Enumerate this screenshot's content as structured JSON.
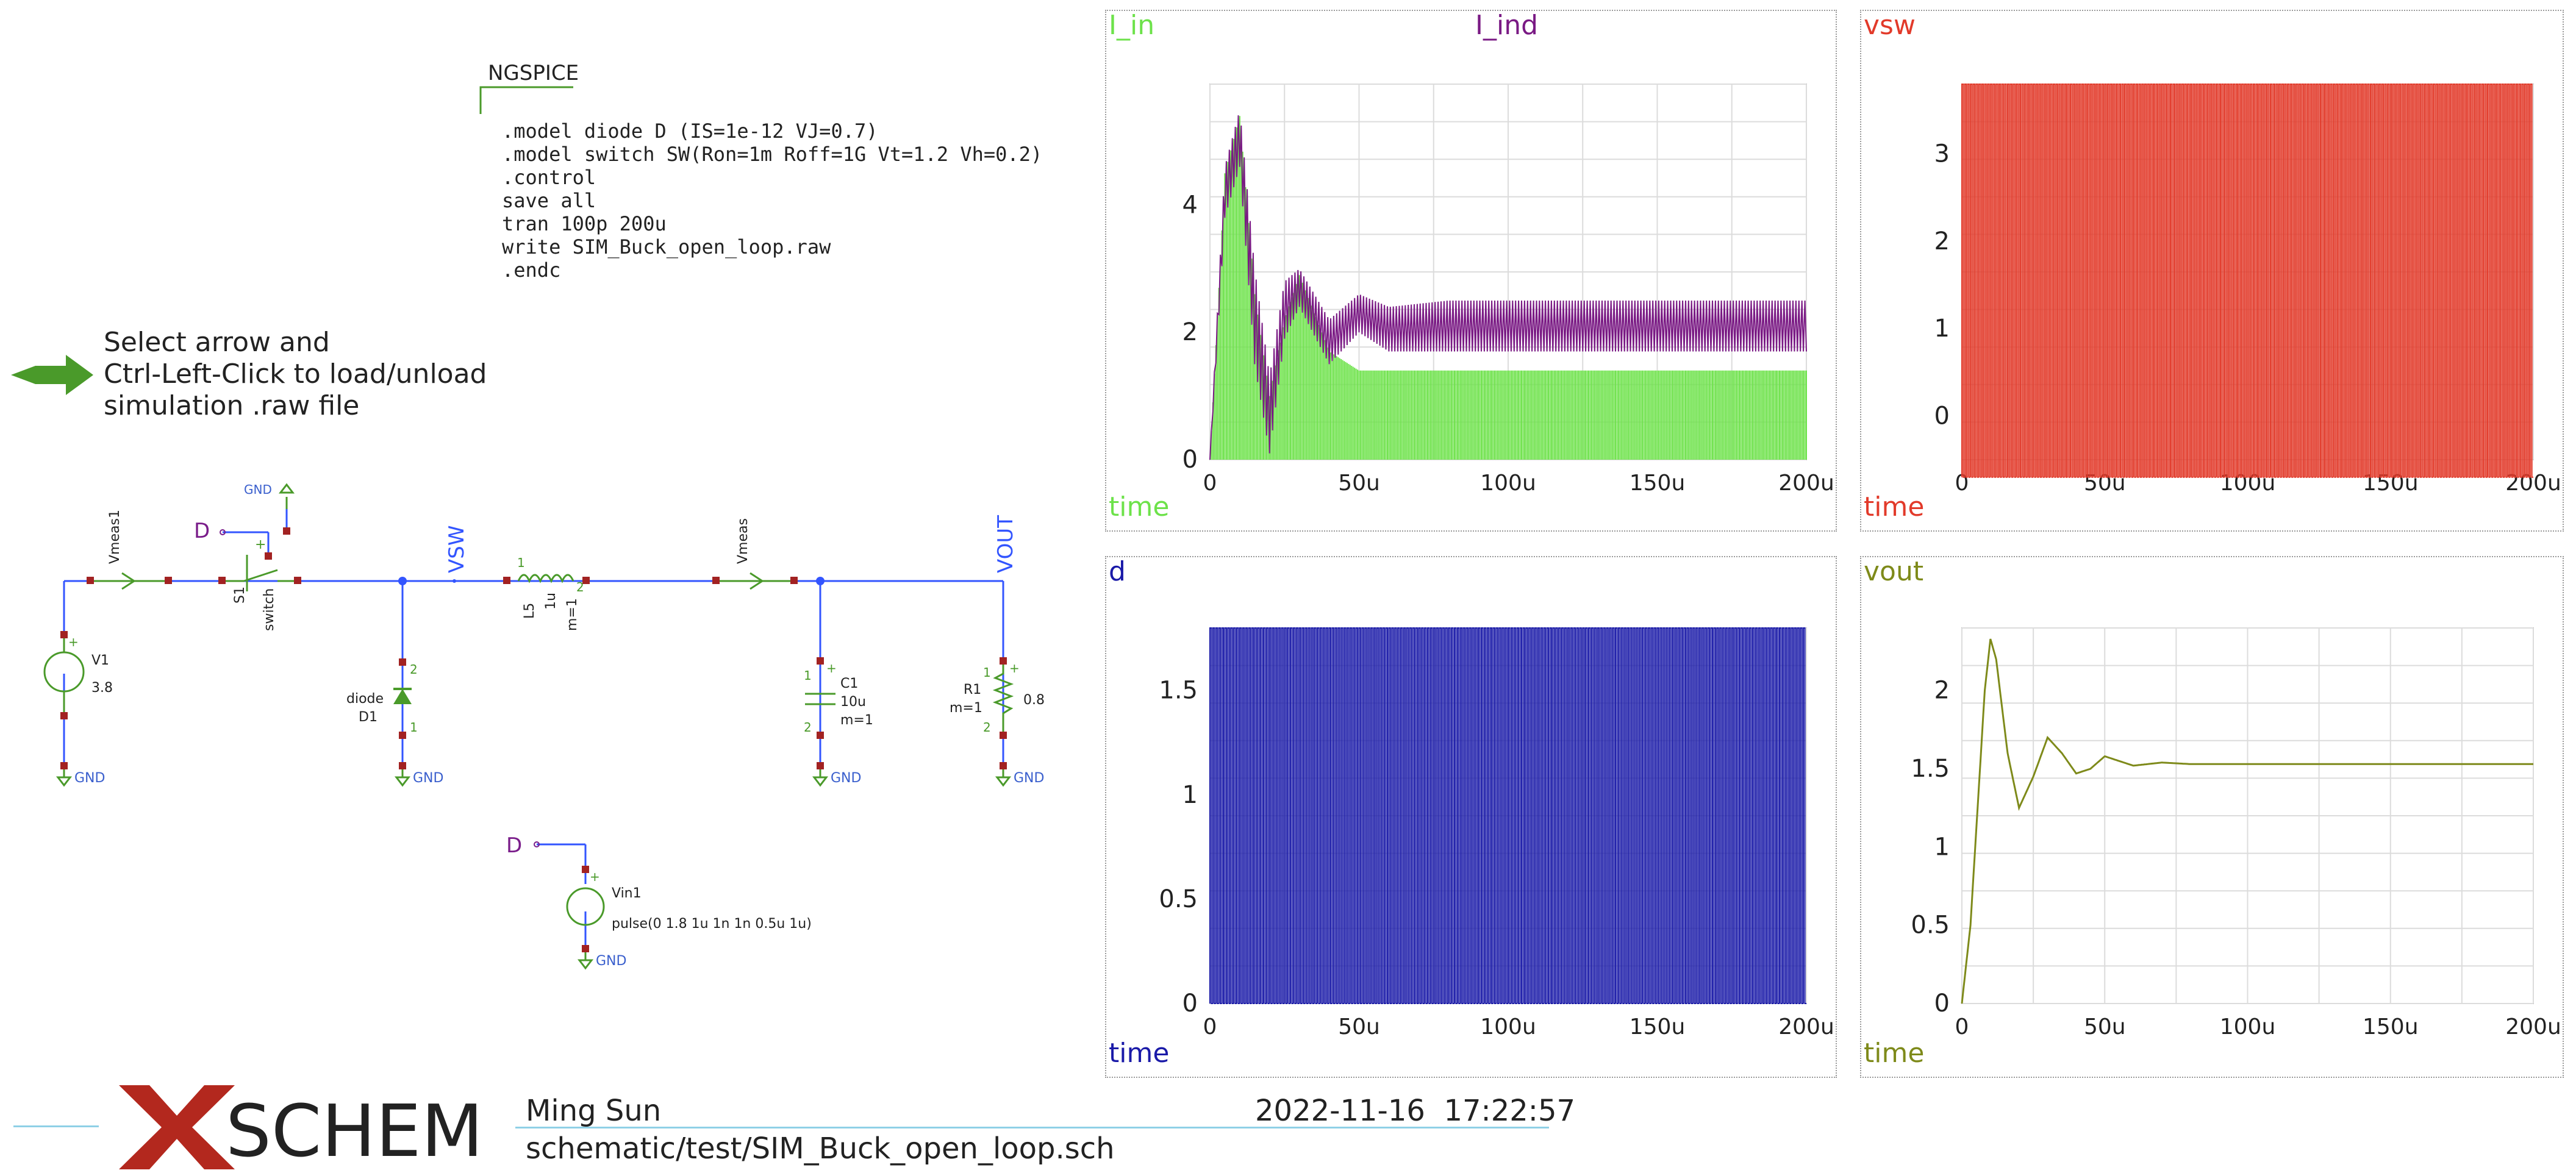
{
  "colors": {
    "wire": "#3355ff",
    "component": "#4a9a2a",
    "pin": "#a22222",
    "gnd_label": "#3a5fcd",
    "net_d": "#7a1d8a",
    "i_in": "#6de24a",
    "i_ind": "#7a1a84",
    "vsw": "#e23a2a",
    "d": "#1a1aa8",
    "vout": "#7e8a1a",
    "xschem_x": "#b3281e"
  },
  "ngspice": {
    "title": "NGSPICE",
    "lines": [
      ".model diode D (IS=1e-12 VJ=0.7)",
      ".model switch SW(Ron=1m Roff=1G Vt=1.2 Vh=0.2)",
      ".control",
      "save all",
      "tran 100p 200u",
      "write SIM_Buck_open_loop.raw",
      ".endc"
    ]
  },
  "load_hint": {
    "icon": "green-arrow-icon",
    "lines": [
      "Select arrow and",
      "Ctrl-Left-Click to load/unload",
      "simulation .raw file"
    ]
  },
  "schematic": {
    "vmeas1": "Vmeas1",
    "s1_name": "S1",
    "s1_model": "switch",
    "d_net": "D",
    "gnd": "GND",
    "vsw": "VSW",
    "l5_name": "L5",
    "l5_val": "1u",
    "l5_m": "m=1",
    "pin1": "1",
    "pin2": "2",
    "vmeas": "Vmeas",
    "vout": "VOUT",
    "v1_name": "V1",
    "v1_val": "3.8",
    "diode_model": "diode",
    "diode_name": "D1",
    "c1_name": "C1",
    "c1_val": "10u",
    "c1_m": "m=1",
    "r1_name": "R1",
    "r1_m": "m=1",
    "r1_val": "0.8",
    "vin1_name": "Vin1",
    "vin1_val": "pulse(0 1.8 1u 1n 1n 0.5u 1u)"
  },
  "graphs": [
    {
      "id": "graph-current",
      "titles": [
        {
          "text": "I_in",
          "color": "#6de24a"
        },
        {
          "text": "I_ind",
          "color": "#7a1a84"
        }
      ],
      "xlabel": "time",
      "xlabel_color": "#6de24a",
      "x_ticks": [
        "0",
        "50u",
        "100u",
        "150u",
        "200u"
      ],
      "y_ticks": [
        "0",
        "2",
        "4"
      ],
      "y_tick_values": [
        0,
        2,
        4
      ],
      "ylim": [
        0,
        5.9
      ],
      "xlim": [
        0,
        200
      ]
    },
    {
      "id": "graph-vsw",
      "titles": [
        {
          "text": "vsw",
          "color": "#e23a2a"
        }
      ],
      "xlabel": "time",
      "xlabel_color": "#e23a2a",
      "x_ticks": [
        "0",
        "50u",
        "100u",
        "150u",
        "200u"
      ],
      "y_ticks": [
        "0",
        "1",
        "2",
        "3"
      ],
      "y_tick_values": [
        0,
        1,
        2,
        3
      ],
      "ylim": [
        -0.5,
        3.8
      ],
      "xlim": [
        0,
        200
      ]
    },
    {
      "id": "graph-d",
      "titles": [
        {
          "text": "d",
          "color": "#1a1aa8"
        }
      ],
      "xlabel": "time",
      "xlabel_color": "#1a1aa8",
      "x_ticks": [
        "0",
        "50u",
        "100u",
        "150u",
        "200u"
      ],
      "y_ticks": [
        "0",
        "0.5",
        "1",
        "1.5"
      ],
      "y_tick_values": [
        0,
        0.5,
        1,
        1.5
      ],
      "ylim": [
        0,
        1.8
      ],
      "xlim": [
        0,
        200
      ]
    },
    {
      "id": "graph-vout",
      "titles": [
        {
          "text": "vout",
          "color": "#7e8a1a"
        }
      ],
      "xlabel": "time",
      "xlabel_color": "#7e8a1a",
      "x_ticks": [
        "0",
        "50u",
        "100u",
        "150u",
        "200u"
      ],
      "y_ticks": [
        "0",
        "0.5",
        "1",
        "1.5",
        "2"
      ],
      "y_tick_values": [
        0,
        0.5,
        1,
        1.5,
        2
      ],
      "ylim": [
        0,
        2.4
      ],
      "xlim": [
        0,
        200
      ]
    }
  ],
  "chart_data": [
    {
      "type": "line",
      "xlabel": "time",
      "ylabel": "",
      "xlim": [
        0,
        200
      ],
      "ylim": [
        0,
        5.9
      ],
      "series": [
        {
          "name": "I_in",
          "note": "switched waveform, envelope shown",
          "x": [
            0,
            5,
            10,
            15,
            20,
            25,
            30,
            40,
            50,
            60,
            80,
            100,
            150,
            200
          ],
          "y_max": [
            0,
            4.5,
            5.4,
            2.6,
            1.0,
            2.2,
            2.9,
            1.7,
            1.4,
            1.4,
            1.4,
            1.4,
            1.4,
            1.4
          ]
        },
        {
          "name": "I_ind",
          "x": [
            0,
            5,
            10,
            15,
            20,
            25,
            30,
            40,
            50,
            60,
            80,
            100,
            150,
            200
          ],
          "y_max": [
            0,
            4.6,
            5.5,
            3.0,
            1.3,
            2.8,
            3.0,
            2.2,
            2.6,
            2.4,
            2.5,
            2.5,
            2.5,
            2.5
          ],
          "y_min": [
            0,
            3.8,
            4.6,
            1.5,
            0.1,
            1.9,
            2.4,
            1.5,
            2.0,
            1.7,
            1.7,
            1.7,
            1.7,
            1.7
          ]
        }
      ]
    },
    {
      "type": "line",
      "xlabel": "time",
      "ylabel": "",
      "xlim": [
        0,
        200
      ],
      "ylim": [
        -0.5,
        3.8
      ],
      "series": [
        {
          "name": "vsw",
          "note": "square wave between approx -0.7 and 3.8",
          "x": [
            0,
            200
          ],
          "y_max": [
            3.8,
            3.8
          ],
          "y_min": [
            -0.7,
            -0.7
          ]
        }
      ]
    },
    {
      "type": "line",
      "xlabel": "time",
      "ylabel": "",
      "xlim": [
        0,
        200
      ],
      "ylim": [
        0,
        1.8
      ],
      "series": [
        {
          "name": "d",
          "note": "pulse between 0 and 1.8, period 1u",
          "x": [
            0,
            200
          ],
          "y_max": [
            1.8,
            1.8
          ],
          "y_min": [
            0,
            0
          ]
        }
      ]
    },
    {
      "type": "line",
      "xlabel": "time",
      "ylabel": "",
      "xlim": [
        0,
        200
      ],
      "ylim": [
        0,
        2.4
      ],
      "series": [
        {
          "name": "vout",
          "x": [
            0,
            3,
            6,
            8,
            10,
            12,
            16,
            20,
            25,
            30,
            35,
            40,
            45,
            50,
            55,
            60,
            70,
            80,
            100,
            150,
            200
          ],
          "y": [
            0,
            0.5,
            1.4,
            2.0,
            2.33,
            2.2,
            1.6,
            1.25,
            1.45,
            1.7,
            1.6,
            1.47,
            1.5,
            1.58,
            1.55,
            1.52,
            1.54,
            1.53,
            1.53,
            1.53,
            1.53
          ]
        }
      ]
    }
  ],
  "footer": {
    "logo_x": "X",
    "logo_text": "SCHEM",
    "author": "Ming Sun",
    "datetime": "2022-11-16  17:22:57",
    "file": "schematic/test/SIM_Buck_open_loop.sch"
  }
}
